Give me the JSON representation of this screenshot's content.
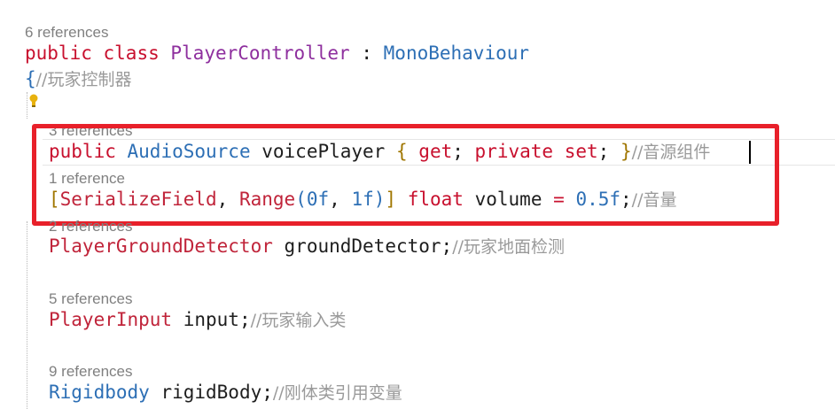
{
  "class_block": {
    "refs": "6 references",
    "kw_public": "public",
    "kw_class": "class",
    "class_name": "PlayerController",
    "colon": ":",
    "base": "MonoBehaviour",
    "open_brace": "{",
    "class_comment": "//玩家控制器"
  },
  "members": [
    {
      "refs": "3 references",
      "kw_public": "public",
      "type": "AudioSource",
      "name": "voicePlayer",
      "b_open": "{",
      "get": "get",
      "semi1": ";",
      "private": "private",
      "set": "set",
      "semi2": ";",
      "b_close": "}",
      "comment": "//音源组件"
    },
    {
      "refs": "1 reference",
      "lbr": "[",
      "attr1": "SerializeField",
      "comma1": ",",
      "attr2": "Range",
      "lp": "(",
      "n1": "0f",
      "comma2": ",",
      "n2": "1f",
      "rp": ")",
      "rbr": "]",
      "type": "float",
      "name": "volume",
      "eq": "=",
      "val": "0.5f",
      "semi": ";",
      "comment": "//音量"
    },
    {
      "refs": "2 references",
      "type": "PlayerGroundDetector",
      "name": "groundDetector",
      "semi": ";",
      "comment": "//玩家地面检测"
    },
    {
      "refs": "5 references",
      "type": "PlayerInput",
      "name": "input",
      "semi": ";",
      "comment": "//玩家输入类"
    },
    {
      "refs": "9 references",
      "type": "Rigidbody",
      "name": "rigidBody",
      "semi": ";",
      "comment": "//刚体类引用变量"
    }
  ],
  "colors": {
    "highlight": "#E8202A",
    "keyword": "#C8102E",
    "type": "#2D6FB5",
    "comment": "#9A9A9A"
  },
  "icons": {
    "lightbulb": "lightbulb-icon"
  }
}
